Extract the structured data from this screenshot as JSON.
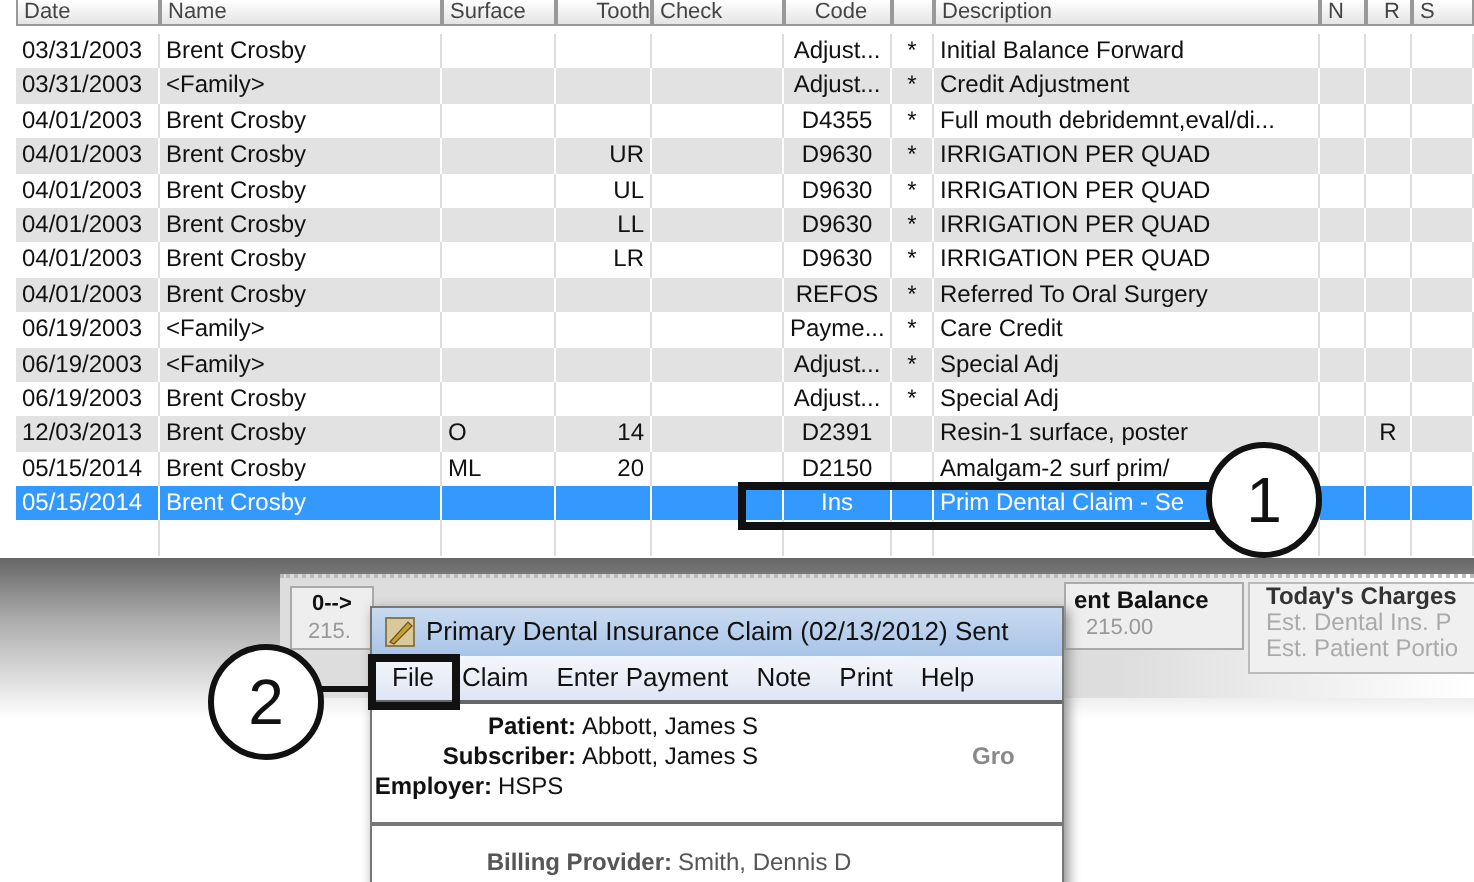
{
  "table": {
    "columns": [
      "Date",
      "Name",
      "Surface",
      "Tooth",
      "Check",
      "Code",
      "Description",
      "N",
      "R",
      "S"
    ],
    "rows": [
      {
        "date": "03/31/2003",
        "name": "Brent Crosby",
        "code": "Adjust...",
        "flag": "*",
        "description": "Initial Balance Forward",
        "selected": false
      },
      {
        "date": "03/31/2003",
        "name": "<Family>",
        "code": "Adjust...",
        "flag": "*",
        "description": "Credit Adjustment",
        "selected": false
      },
      {
        "date": "04/01/2003",
        "name": "Brent Crosby",
        "code": "D4355",
        "flag": "*",
        "description": "Full mouth debridemnt,eval/di...",
        "selected": false
      },
      {
        "date": "04/01/2003",
        "name": "Brent Crosby",
        "tooth": "UR",
        "code": "D9630",
        "flag": "*",
        "description": "IRRIGATION PER QUAD",
        "selected": false
      },
      {
        "date": "04/01/2003",
        "name": "Brent Crosby",
        "tooth": "UL",
        "code": "D9630",
        "flag": "*",
        "description": "IRRIGATION PER QUAD",
        "selected": false
      },
      {
        "date": "04/01/2003",
        "name": "Brent Crosby",
        "tooth": "LL",
        "code": "D9630",
        "flag": "*",
        "description": "IRRIGATION PER QUAD",
        "selected": false
      },
      {
        "date": "04/01/2003",
        "name": "Brent Crosby",
        "tooth": "LR",
        "code": "D9630",
        "flag": "*",
        "description": "IRRIGATION PER QUAD",
        "selected": false
      },
      {
        "date": "04/01/2003",
        "name": "Brent Crosby",
        "code": "REFOS",
        "flag": "*",
        "description": "Referred To Oral Surgery",
        "selected": false
      },
      {
        "date": "06/19/2003",
        "name": "<Family>",
        "code": "Payme...",
        "flag": "*",
        "description": "Care Credit",
        "selected": false
      },
      {
        "date": "06/19/2003",
        "name": "<Family>",
        "code": "Adjust...",
        "flag": "*",
        "description": "Special Adj",
        "selected": false
      },
      {
        "date": "06/19/2003",
        "name": "Brent Crosby",
        "code": "Adjust...",
        "flag": "*",
        "description": "Special Adj",
        "selected": false
      },
      {
        "date": "12/03/2013",
        "name": "Brent Crosby",
        "surface": "O",
        "tooth": "14",
        "code": "D2391",
        "description": "Resin-1 surface, poster",
        "r": "R",
        "selected": false
      },
      {
        "date": "05/15/2014",
        "name": "Brent Crosby",
        "surface": "ML",
        "tooth": "20",
        "code": "D2150",
        "description": "Amalgam-2 surf prim/",
        "selected": false
      },
      {
        "date": "05/15/2014",
        "name": "Brent Crosby",
        "code": "Ins",
        "description": "Prim Dental Claim - Se",
        "selected": true
      }
    ]
  },
  "account_panel": {
    "tab": "0-->",
    "tab_value": "215.",
    "balance_label": "ent Balance",
    "balance_value": "215.00",
    "todays_charges": {
      "title": "Today's Charges",
      "lines": [
        "Est. Dental Ins. P",
        "Est. Patient Portio"
      ]
    }
  },
  "claim_window": {
    "title": "Primary Dental Insurance Claim (02/13/2012) Sent",
    "menu": [
      "File",
      "Claim",
      "Enter Payment",
      "Note",
      "Print",
      "Help"
    ],
    "fields": [
      {
        "label": "Patient:",
        "value": "Abbott, James S"
      },
      {
        "label": "Subscriber:",
        "value": "Abbott, James S"
      },
      {
        "label": "Employer:",
        "value": "HSPS"
      }
    ],
    "group_label": "Gro",
    "billing": {
      "label": "Billing Provider:",
      "value": "Smith, Dennis D"
    }
  },
  "callouts": [
    {
      "number": "1"
    },
    {
      "number": "2"
    }
  ]
}
